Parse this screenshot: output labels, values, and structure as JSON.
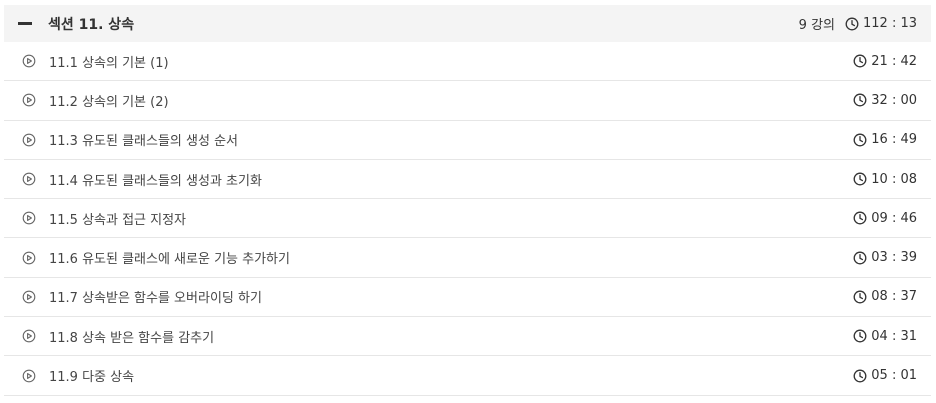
{
  "section": {
    "title": "섹션 11. 상속",
    "lecture_count": "9 강의",
    "total_duration": "112 : 13"
  },
  "lectures": [
    {
      "title": "11.1 상속의 기본 (1)",
      "duration": "21 : 42"
    },
    {
      "title": "11.2 상속의 기본 (2)",
      "duration": "32 : 00"
    },
    {
      "title": "11.3 유도된 클래스들의 생성 순서",
      "duration": "16 : 49"
    },
    {
      "title": "11.4 유도된 클래스들의 생성과 초기화",
      "duration": "10 : 08"
    },
    {
      "title": "11.5 상속과 접근 지정자",
      "duration": "09 : 46"
    },
    {
      "title": "11.6 유도된 클래스에 새로운 기능 추가하기",
      "duration": "03 : 39"
    },
    {
      "title": "11.7 상속받은 함수를 오버라이딩 하기",
      "duration": "08 : 37"
    },
    {
      "title": "11.8 상속 받은 함수를 감추기",
      "duration": "04 : 31"
    },
    {
      "title": "11.9 다중 상속",
      "duration": "05 : 01"
    }
  ],
  "icons": {
    "collapse": "minus-icon",
    "clock": "clock-icon",
    "play": "play-circle-icon"
  }
}
